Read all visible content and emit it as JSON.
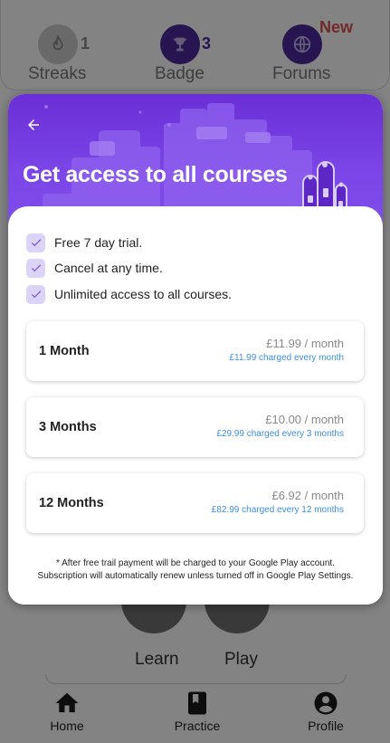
{
  "background": {
    "stats": [
      {
        "count": "1",
        "label": "Streaks",
        "icon": "streak-icon"
      },
      {
        "count": "3",
        "label": "Badge",
        "icon": "trophy-icon"
      },
      {
        "count": "",
        "label": "Forums",
        "icon": "globe-icon",
        "badge": "New"
      }
    ],
    "actions": [
      {
        "label": "Learn"
      },
      {
        "label": "Play"
      }
    ],
    "bottom_nav": [
      {
        "label": "Home",
        "icon": "home-icon"
      },
      {
        "label": "Practice",
        "icon": "book-icon"
      },
      {
        "label": "Profile",
        "icon": "profile-icon"
      }
    ]
  },
  "modal": {
    "title": "Get access to all courses",
    "features": [
      "Free 7 day trial.",
      "Cancel at any time.",
      "Unlimited access to all courses."
    ],
    "plans": [
      {
        "name": "1 Month",
        "price": "£11.99",
        "period": " / month",
        "charge": "£11.99 charged every month"
      },
      {
        "name": "3 Months",
        "price": "£10.00",
        "period": " / month",
        "charge": "£29.99 charged every 3 months"
      },
      {
        "name": "12 Months",
        "price": "£6.92",
        "period": " / month",
        "charge": "£82.99 charged every 12 months"
      }
    ],
    "footnote": "* After free trail payment will be charged to your Google Play account. Subscription will automatically renew unless turned off in Google Play Settings."
  },
  "colors": {
    "hero_purple": "#6a2fd6",
    "check_bg": "#dcd3f8",
    "link_blue": "#3d8fe0",
    "new_red": "#d9534f"
  }
}
